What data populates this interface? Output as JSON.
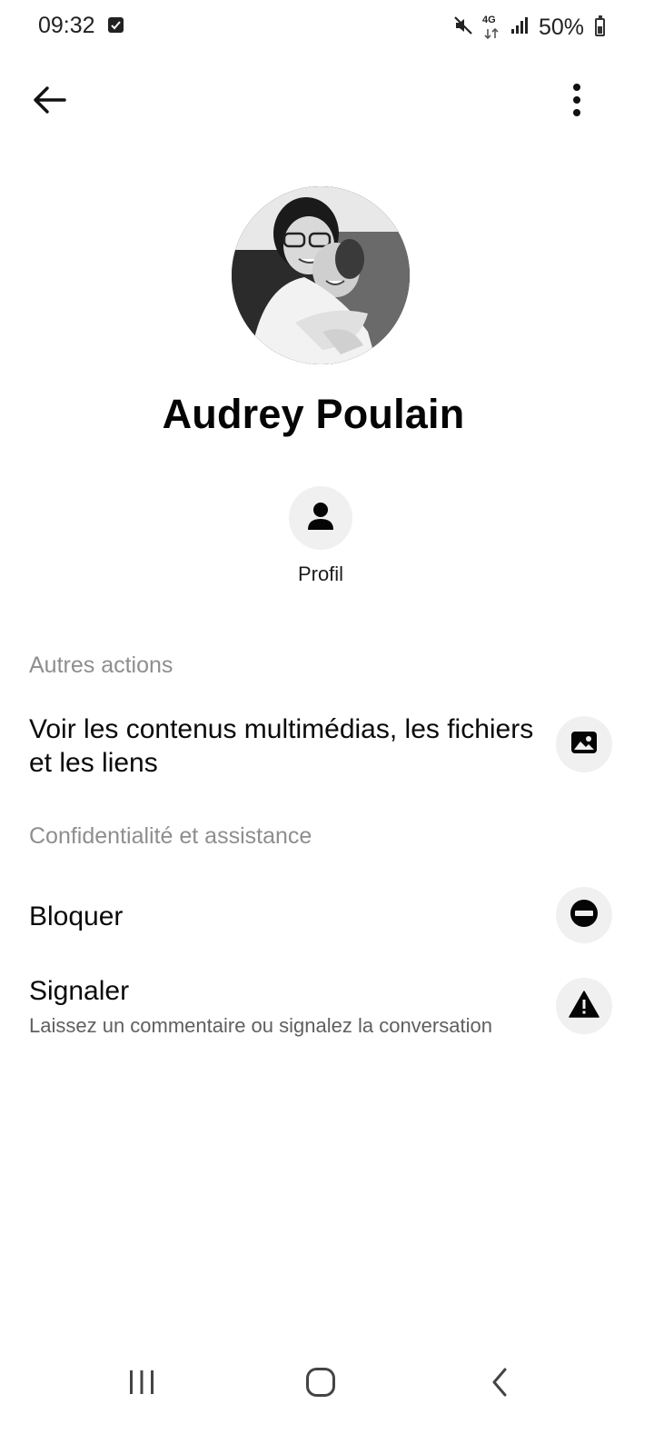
{
  "status_bar": {
    "time": "09:32",
    "network": "4G",
    "battery": "50%"
  },
  "header": {
    "back_icon": "arrow-left-icon",
    "menu_icon": "more-vertical-icon"
  },
  "contact": {
    "name": "Audrey Poulain"
  },
  "profile_action": {
    "label": "Profil",
    "icon": "person-icon"
  },
  "sections": {
    "other_actions": {
      "heading": "Autres actions",
      "media_row": {
        "title": "Voir les contenus multimédias, les fichiers et les liens",
        "icon": "image-icon"
      }
    },
    "privacy": {
      "heading": "Confidentialité et assistance",
      "block_row": {
        "title": "Bloquer",
        "icon": "block-icon"
      },
      "report_row": {
        "title": "Signaler",
        "subtitle": "Laissez un commentaire ou signalez la conversation",
        "icon": "warning-icon"
      }
    }
  },
  "nav_bar": {
    "recents_icon": "recent-apps-icon",
    "home_icon": "home-icon",
    "back_icon": "back-chevron-icon"
  }
}
